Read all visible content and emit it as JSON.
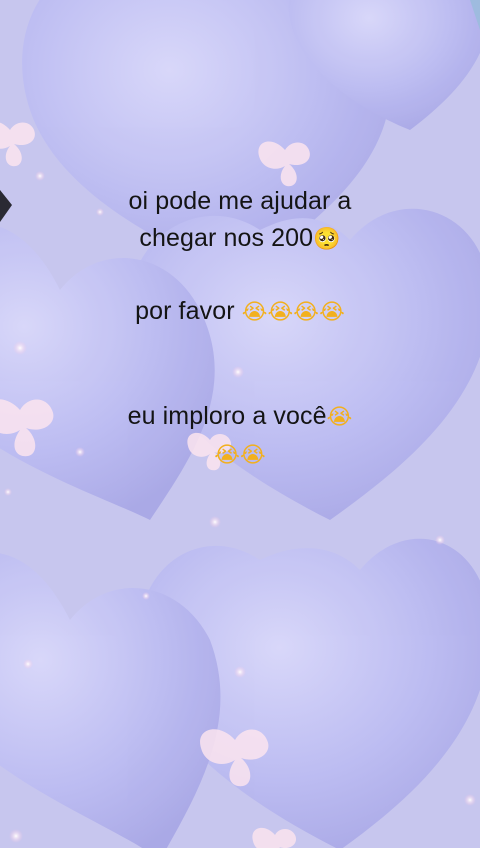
{
  "message": {
    "line1": "oi pode me ajudar a",
    "line2": "chegar nos 200",
    "line2_emoji": "🥺",
    "line3": "por favor",
    "line3_emoji": "😭😭😭😭",
    "line4": "eu imploro a você",
    "line4_emoji": "😭",
    "line5_emoji": "😭😭"
  },
  "background": {
    "base_color": "#c7c6ee",
    "heart_color": "#b9b9f0",
    "sparkle_color": "#fbe4ef",
    "decoration": "heart-and-butterfly-pattern"
  }
}
